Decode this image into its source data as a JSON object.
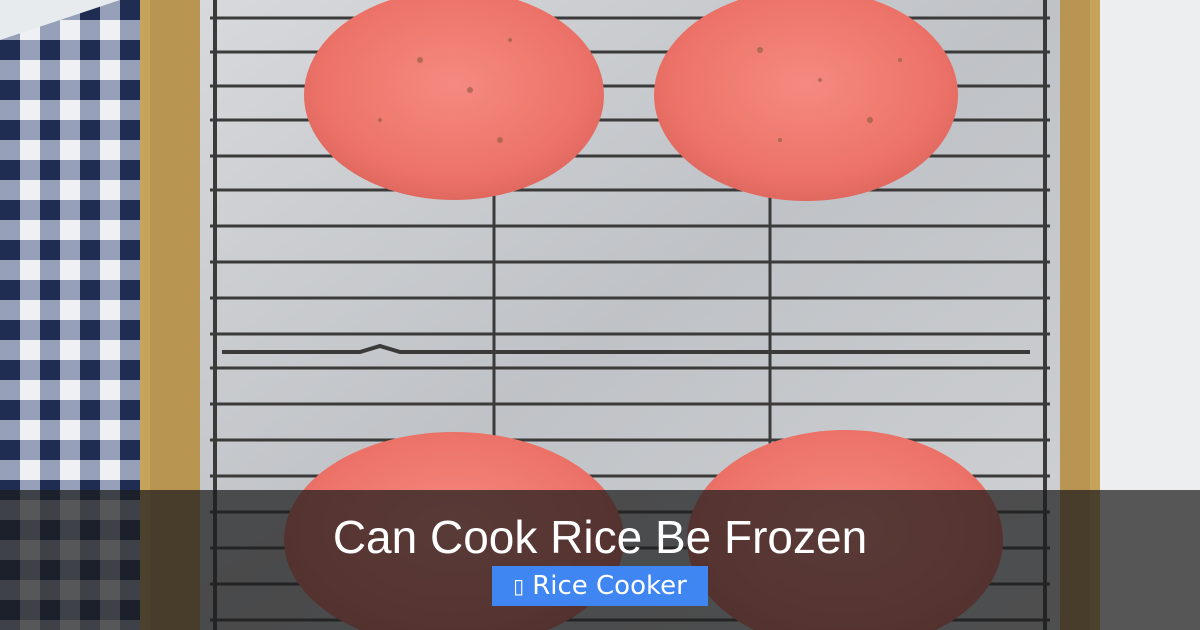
{
  "headline": "Can Cook Rice Be Frozen",
  "category": {
    "icon": "tag-icon",
    "label": "Rice Cooker",
    "color": "#3f86f2"
  },
  "photo": {
    "subject": "raw burger patties on a wire cooling rack",
    "colors": {
      "patty": "#f07a70",
      "tray": "#c8a45a",
      "cloth_blue": "#2a3a63",
      "foil": "#c9cbce"
    }
  }
}
